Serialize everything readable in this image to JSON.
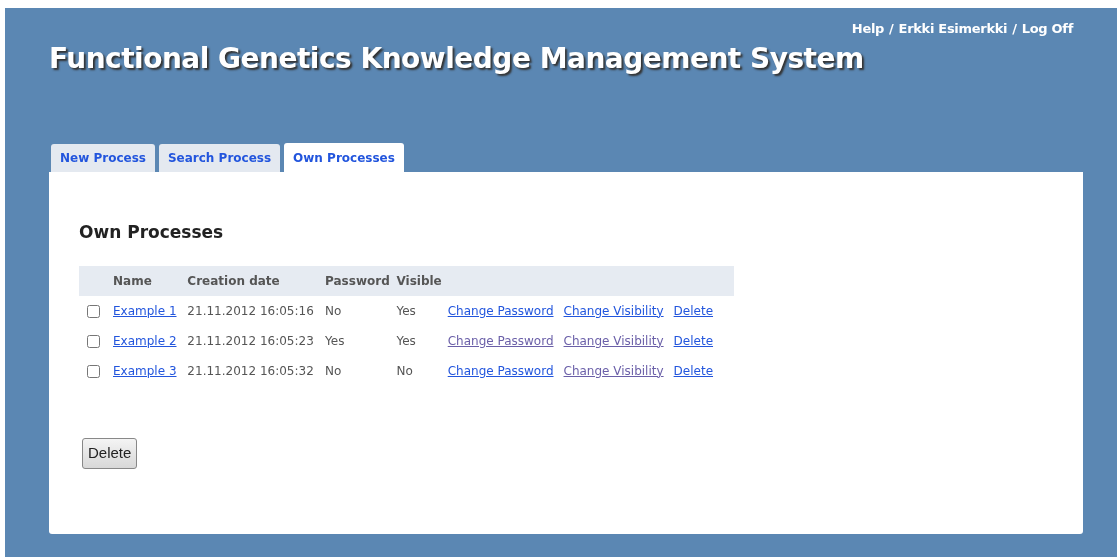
{
  "header": {
    "title": "Functional Genetics Knowledge Management System",
    "user_links": [
      {
        "label": "Help"
      },
      {
        "label": "Erkki Esimerkki"
      },
      {
        "label": "Log Off"
      }
    ],
    "separator": "/"
  },
  "tabs": [
    {
      "label": "New Process",
      "selected": false
    },
    {
      "label": "Search Process",
      "selected": false
    },
    {
      "label": "Own Processes",
      "selected": true
    }
  ],
  "panel": {
    "heading": "Own Processes",
    "table": {
      "columns": [
        "Name",
        "Creation date",
        "Password",
        "Visible"
      ],
      "rows": [
        {
          "checked": false,
          "name": "Example 1",
          "created": "21.11.2012 16:05:16",
          "password": "No",
          "visible": "Yes",
          "actions": [
            {
              "label": "Change Password",
              "visited": false
            },
            {
              "label": "Change Visibility",
              "visited": false
            },
            {
              "label": "Delete",
              "visited": false
            }
          ]
        },
        {
          "checked": false,
          "name": "Example 2",
          "created": "21.11.2012 16:05:23",
          "password": "Yes",
          "visible": "Yes",
          "actions": [
            {
              "label": "Change Password",
              "visited": true
            },
            {
              "label": "Change Visibility",
              "visited": true
            },
            {
              "label": "Delete",
              "visited": false
            }
          ]
        },
        {
          "checked": false,
          "name": "Example 3",
          "created": "21.11.2012 16:05:32",
          "password": "No",
          "visible": "No",
          "actions": [
            {
              "label": "Change Password",
              "visited": false
            },
            {
              "label": "Change Visibility",
              "visited": true
            },
            {
              "label": "Delete",
              "visited": false
            }
          ]
        }
      ]
    },
    "button": "Delete"
  }
}
